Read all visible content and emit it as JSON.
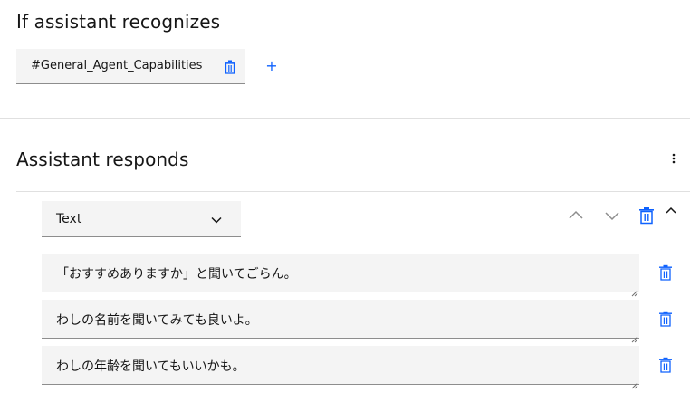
{
  "condition": {
    "heading": "If assistant recognizes",
    "intent_value": "#General_Agent_Capabilities",
    "delete_icon": "trash-icon",
    "add_label": "+"
  },
  "responses": {
    "heading": "Assistant responds",
    "menu_icon": "overflow-menu-icon",
    "type_select": {
      "selected": "Text"
    },
    "items": [
      {
        "text": "「おすすめありますか」と聞いてごらん。"
      },
      {
        "text": "わしの名前を聞いてみても良いよ。"
      },
      {
        "text": "わしの年齢を聞いてもいいかも。"
      }
    ]
  },
  "colors": {
    "accent": "#0f62fe",
    "field_bg": "#f4f4f4",
    "divider": "#e0e0e0"
  }
}
